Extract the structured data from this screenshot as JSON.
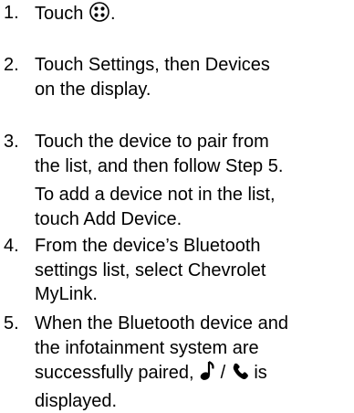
{
  "steps": [
    {
      "number": "1.",
      "lines": [
        "Touch",
        "."
      ],
      "icon": "apps-icon"
    },
    {
      "number": "2.",
      "lines": [
        "Touch Settings, then Devices",
        "on the display."
      ]
    },
    {
      "number": "3.",
      "lines": [
        "Touch the device to pair from",
        "the list, and then follow Step 5."
      ],
      "note_lines": [
        "To add a device not in the list,",
        "touch Add Device."
      ]
    },
    {
      "number": "4.",
      "lines": [
        "From the device’s Bluetooth",
        "settings list, select Chevrolet",
        "MyLink."
      ]
    },
    {
      "number": "5.",
      "lines": [
        "When the Bluetooth device and",
        "the infotainment system are",
        "successfully paired,",
        "/",
        "is",
        "displayed."
      ],
      "icons": [
        "music-note-icon",
        "phone-icon"
      ]
    }
  ]
}
